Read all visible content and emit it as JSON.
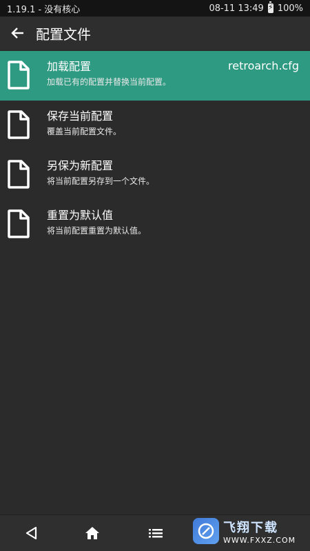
{
  "statusbar": {
    "left": "1.19.1 - 没有核心",
    "time": "08-11 13:49",
    "battery": "100%"
  },
  "header": {
    "title": "配置文件"
  },
  "items": [
    {
      "title": "加载配置",
      "subtitle": "加载已有的配置并替换当前配置。",
      "value": "retroarch.cfg",
      "active": true
    },
    {
      "title": "保存当前配置",
      "subtitle": "覆盖当前配置文件。"
    },
    {
      "title": "另保为新配置",
      "subtitle": "将当前配置另存到一个文件。"
    },
    {
      "title": "重置为默认值",
      "subtitle": "将当前配置重置为默认值。"
    }
  ],
  "watermark": {
    "brand": "飞翔下载",
    "domain": "WWW.FXXZ.COM"
  },
  "icons": {
    "back": "arrow-back-icon",
    "item": "file-icon",
    "nav": [
      "back-triangle-icon",
      "home-icon",
      "menu-list-icon"
    ]
  }
}
